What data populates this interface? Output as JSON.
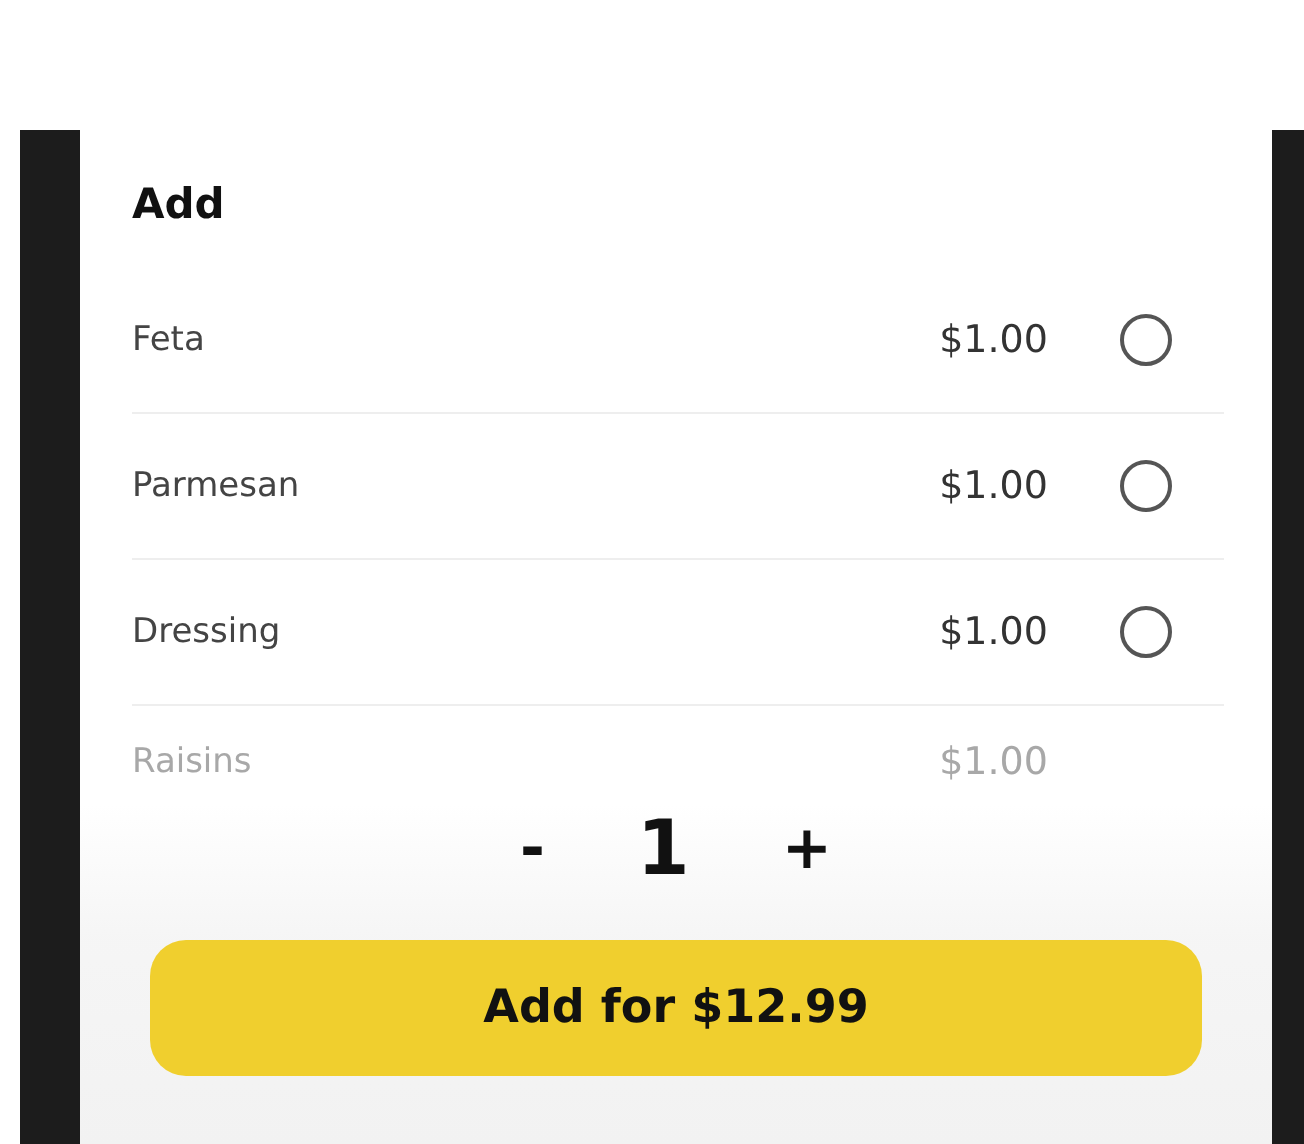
{
  "section": {
    "title": "Add"
  },
  "options": [
    {
      "name": "Feta",
      "price": "$1.00",
      "selected": false,
      "faded": false
    },
    {
      "name": "Parmesan",
      "price": "$1.00",
      "selected": false,
      "faded": false
    },
    {
      "name": "Dressing",
      "price": "$1.00",
      "selected": false,
      "faded": false
    },
    {
      "name": "Raisins",
      "price": "$1.00",
      "faded": true
    }
  ],
  "quantity": {
    "decrement": "-",
    "value": "1",
    "increment": "+"
  },
  "add_button": {
    "label": "Add for $12.99"
  }
}
